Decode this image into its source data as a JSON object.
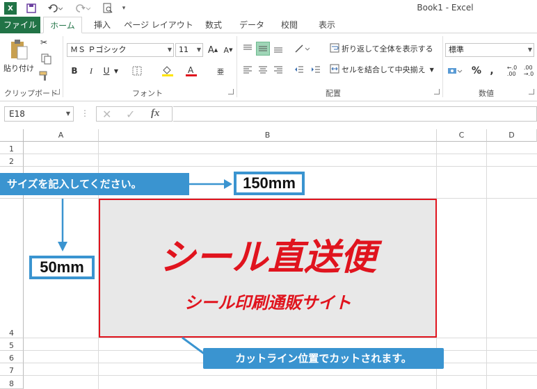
{
  "window": {
    "title": "Book1 - Excel"
  },
  "quick_access": {
    "save_icon": "save-icon",
    "undo_icon": "undo-icon",
    "redo_icon": "redo-icon",
    "preview_icon": "print-preview-icon"
  },
  "tabs": [
    {
      "label": "ファイル"
    },
    {
      "label": "ホーム"
    },
    {
      "label": "挿入"
    },
    {
      "label": "ページ レイアウト"
    },
    {
      "label": "数式"
    },
    {
      "label": "データ"
    },
    {
      "label": "校閲"
    },
    {
      "label": "表示"
    }
  ],
  "ribbon": {
    "clipboard": {
      "paste_label": "貼り付け",
      "group_label": "クリップボード"
    },
    "font": {
      "font_name": "ＭＳ Ｐゴシック",
      "font_size": "11",
      "group_label": "フォント",
      "bold": "B",
      "italic": "I",
      "underline": "U"
    },
    "alignment": {
      "wrap_text": "折り返して全体を表示する",
      "merge_center": "セルを結合して中央揃え",
      "group_label": "配置"
    },
    "number": {
      "format": "標準",
      "group_label": "数値",
      "percent": "%",
      "comma": ","
    }
  },
  "formula_bar": {
    "name_box": "E18",
    "fx": "fx",
    "formula": ""
  },
  "grid": {
    "columns": [
      "A",
      "B",
      "C",
      "D"
    ],
    "rows": [
      "1",
      "2",
      "4",
      "5",
      "6",
      "7",
      "8"
    ]
  },
  "annotations": {
    "size_instruction": "サイズを記入してください。",
    "width_value": "150mm",
    "height_value": "50mm",
    "cut_line_note": "カットライン位置でカットされます。",
    "accent_color": "#3a94d0"
  },
  "label_preview": {
    "main_text": "シール直送便",
    "sub_text": "シール印刷通販サイト",
    "text_color": "#e0141e",
    "border_color": "#e0141e",
    "background": "#e8e8e8"
  }
}
